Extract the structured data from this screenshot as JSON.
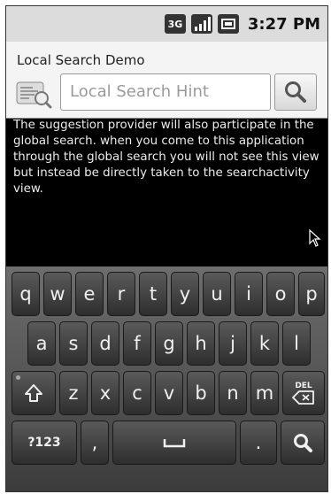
{
  "status_bar": {
    "time": "3:27 PM",
    "network": "3G"
  },
  "search_panel": {
    "title": "Local Search Demo",
    "placeholder": "Local Search Hint"
  },
  "description": "The suggestion provider will also participate in the global search. when you come to this application through the global search you will not see this view but instead be directly taken to the searchactivity view.",
  "keyboard": {
    "row1": [
      "q",
      "w",
      "e",
      "r",
      "t",
      "y",
      "u",
      "i",
      "o",
      "p"
    ],
    "row2": [
      "a",
      "s",
      "d",
      "f",
      "g",
      "h",
      "j",
      "k",
      "l"
    ],
    "row3": [
      "z",
      "x",
      "c",
      "v",
      "b",
      "n",
      "m"
    ],
    "sym": "?123",
    "comma": ",",
    "period": ".",
    "del": "DEL"
  }
}
